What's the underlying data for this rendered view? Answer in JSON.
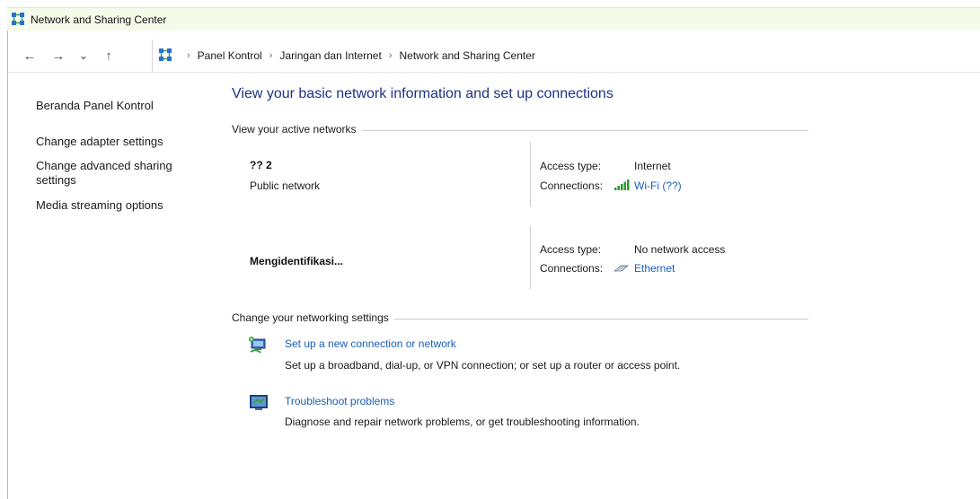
{
  "window": {
    "title": "Network and Sharing Center"
  },
  "nav": {
    "back": "←",
    "forward": "→",
    "history": "⌄",
    "up": "↑"
  },
  "breadcrumb": [
    "Panel Kontrol",
    "Jaringan dan Internet",
    "Network and Sharing Center"
  ],
  "sidebar": {
    "items": [
      "Beranda Panel Kontrol",
      "Change adapter settings",
      "Change advanced sharing settings",
      "Media streaming options"
    ]
  },
  "main": {
    "headline": "View your basic network information and set up connections",
    "active_networks_label": "View your active networks",
    "networks": [
      {
        "name": "?? 2",
        "type": "Public network",
        "access_type_label": "Access type:",
        "access_type": "Internet",
        "connections_label": "Connections:",
        "connection": "Wi-Fi (??)",
        "connection_icon": "wifi-signal-icon"
      },
      {
        "name": "Mengidentifikasi...",
        "type": "",
        "access_type_label": "Access type:",
        "access_type": "No network access",
        "connections_label": "Connections:",
        "connection": "Ethernet",
        "connection_icon": "ethernet-icon"
      }
    ],
    "change_settings_label": "Change your networking settings",
    "tasks": [
      {
        "link": "Set up a new connection or network",
        "desc": "Set up a broadband, dial-up, or VPN connection; or set up a router or access point.",
        "icon": "new-connection-icon"
      },
      {
        "link": "Troubleshoot problems",
        "desc": "Diagnose and repair network problems, or get troubleshooting information.",
        "icon": "troubleshoot-icon"
      }
    ]
  },
  "colors": {
    "link": "#1a5fb4",
    "headline": "#1e3287",
    "titlebar": "#f4fbe9"
  }
}
